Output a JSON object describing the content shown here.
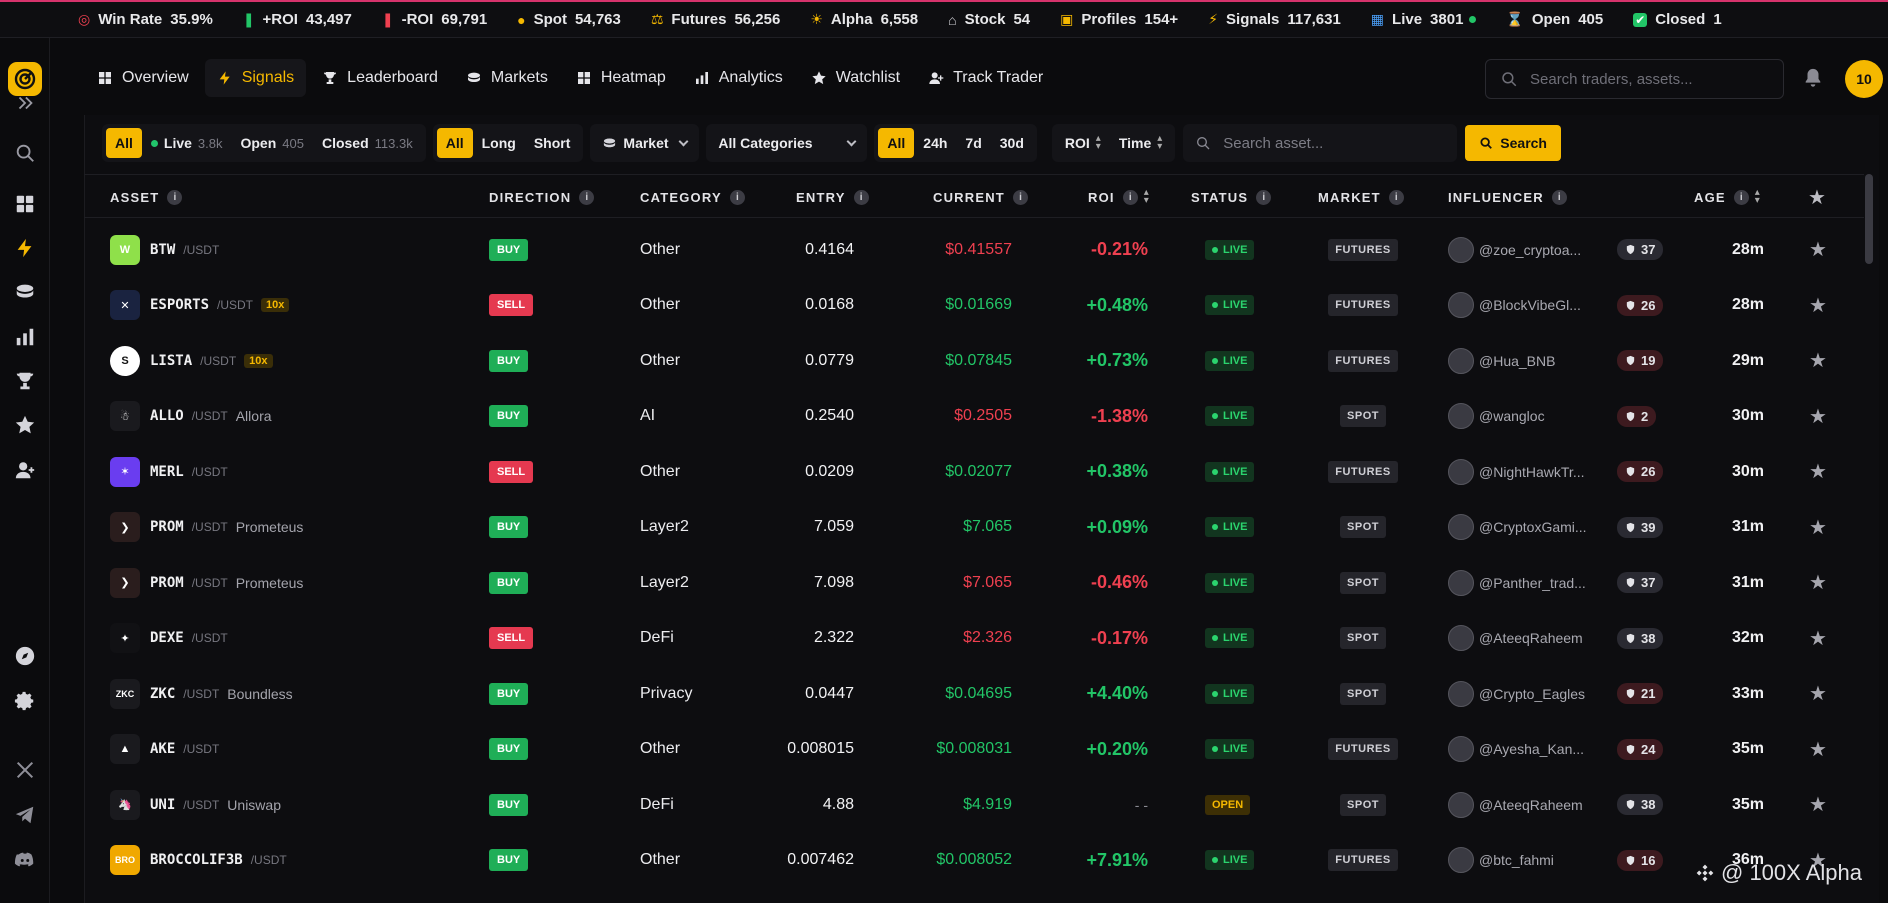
{
  "ticker": [
    {
      "icon": "target-icon",
      "label": "Win Rate",
      "value": "35.9%",
      "color": "#ef4050"
    },
    {
      "icon": "candle-green-icon",
      "label": "+ROI",
      "value": "43,497",
      "color": "#22c567"
    },
    {
      "icon": "candle-red-icon",
      "label": "-ROI",
      "value": "69,791",
      "color": "#ef4050"
    },
    {
      "icon": "coin-icon",
      "label": "Spot",
      "value": "54,763",
      "color": "#f5b800"
    },
    {
      "icon": "scale-icon",
      "label": "Futures",
      "value": "56,256",
      "color": "#f5b800"
    },
    {
      "icon": "sun-icon",
      "label": "Alpha",
      "value": "6,558",
      "color": "#f5b800"
    },
    {
      "icon": "bank-icon",
      "label": "Stock",
      "value": "54",
      "color": "#cfcfd4"
    },
    {
      "icon": "profile-card-icon",
      "label": "Profiles",
      "value": "154+",
      "color": "#f5b800"
    },
    {
      "icon": "lightning-icon",
      "label": "Signals",
      "value": "117,631",
      "color": "#f5b800"
    },
    {
      "icon": "chart-icon",
      "label": "Live",
      "value": "3801",
      "color": "#4a9df5"
    },
    {
      "icon": "hourglass-icon",
      "label": "Open",
      "value": "405",
      "color": "#f5b800"
    },
    {
      "icon": "check-icon",
      "label": "Closed",
      "value": "1",
      "color": "#22c567"
    }
  ],
  "nav": [
    {
      "label": "Overview",
      "icon": "grid-icon",
      "active": false
    },
    {
      "label": "Signals",
      "icon": "lightning-icon",
      "active": true
    },
    {
      "label": "Leaderboard",
      "icon": "trophy-icon",
      "active": false
    },
    {
      "label": "Markets",
      "icon": "coins-icon",
      "active": false
    },
    {
      "label": "Heatmap",
      "icon": "heatmap-icon",
      "active": false
    },
    {
      "label": "Analytics",
      "icon": "bar-chart-icon",
      "active": false
    },
    {
      "label": "Watchlist",
      "icon": "star-icon",
      "active": false
    },
    {
      "label": "Track Trader",
      "icon": "user-plus-icon",
      "active": false
    }
  ],
  "search": {
    "placeholder": "Search traders, assets..."
  },
  "notifications": {
    "count": "10"
  },
  "filters": {
    "status": [
      {
        "label": "All",
        "count": "",
        "on": true
      },
      {
        "label": "Live",
        "count": "3.8k",
        "on": false
      },
      {
        "label": "Open",
        "count": "405",
        "on": false
      },
      {
        "label": "Closed",
        "count": "113.3k",
        "on": false
      }
    ],
    "direction": [
      {
        "label": "All",
        "on": true
      },
      {
        "label": "Long",
        "on": false
      },
      {
        "label": "Short",
        "on": false
      }
    ],
    "market_dropdown": "Market",
    "category_dropdown": "All Categories",
    "time": [
      {
        "label": "All",
        "on": true
      },
      {
        "label": "24h",
        "on": false
      },
      {
        "label": "7d",
        "on": false
      },
      {
        "label": "30d",
        "on": false
      }
    ],
    "sort_roi": "ROI",
    "sort_time": "Time",
    "asset_placeholder": "Search asset...",
    "search_button": "Search"
  },
  "table": {
    "headers": {
      "asset": "ASSET",
      "direction": "DIRECTION",
      "category": "CATEGORY",
      "entry": "ENTRY",
      "current": "CURRENT",
      "roi": "ROI",
      "status": "STATUS",
      "market": "MARKET",
      "influencer": "INFLUENCER",
      "age": "AGE"
    },
    "rows": [
      {
        "symbol": "BTW",
        "pair": "/USDT",
        "lev": "",
        "name": "",
        "coin_color": "#8fe04a",
        "coin_text": "W",
        "dir": "BUY",
        "category": "Other",
        "entry": "0.4164",
        "current": "$0.41557",
        "current_color": "red",
        "roi": "-0.21%",
        "roi_color": "red",
        "status": "LIVE",
        "market": "FUTURES",
        "handle": "@zoe_cryptoa...",
        "score": "37",
        "score_tone": "gray",
        "age": "28m"
      },
      {
        "symbol": "ESPORTS",
        "pair": "/USDT",
        "lev": "10x",
        "name": "",
        "coin_color": "#1a2340",
        "coin_text": "✕",
        "dir": "SELL",
        "category": "Other",
        "entry": "0.0168",
        "current": "$0.01669",
        "current_color": "green",
        "roi": "+0.48%",
        "roi_color": "green",
        "status": "LIVE",
        "market": "FUTURES",
        "handle": "@BlockVibeGl...",
        "score": "26",
        "score_tone": "red",
        "age": "28m"
      },
      {
        "symbol": "LISTA",
        "pair": "/USDT",
        "lev": "10x",
        "name": "",
        "coin_color": "#ffffff",
        "coin_text": "S",
        "dir": "BUY",
        "category": "Other",
        "entry": "0.0779",
        "current": "$0.07845",
        "current_color": "green",
        "roi": "+0.73%",
        "roi_color": "green",
        "status": "LIVE",
        "market": "FUTURES",
        "handle": "@Hua_BNB",
        "score": "19",
        "score_tone": "red",
        "age": "29m"
      },
      {
        "symbol": "ALLO",
        "pair": "/USDT",
        "lev": "",
        "name": "Allora",
        "coin_color": "#1a1a1e",
        "coin_text": "☃",
        "dir": "BUY",
        "category": "AI",
        "entry": "0.2540",
        "current": "$0.2505",
        "current_color": "red",
        "roi": "-1.38%",
        "roi_color": "red",
        "status": "LIVE",
        "market": "SPOT",
        "handle": "@wangloc",
        "score": "2",
        "score_tone": "red",
        "age": "30m"
      },
      {
        "symbol": "MERL",
        "pair": "/USDT",
        "lev": "",
        "name": "",
        "coin_color": "#6a3df0",
        "coin_text": "✶",
        "dir": "SELL",
        "category": "Other",
        "entry": "0.0209",
        "current": "$0.02077",
        "current_color": "green",
        "roi": "+0.38%",
        "roi_color": "green",
        "status": "LIVE",
        "market": "FUTURES",
        "handle": "@NightHawkTr...",
        "score": "26",
        "score_tone": "red",
        "age": "30m"
      },
      {
        "symbol": "PROM",
        "pair": "/USDT",
        "lev": "",
        "name": "Prometeus",
        "coin_color": "#2a1d1d",
        "coin_text": "❯",
        "dir": "BUY",
        "category": "Layer2",
        "entry": "7.059",
        "current": "$7.065",
        "current_color": "green",
        "roi": "+0.09%",
        "roi_color": "green",
        "status": "LIVE",
        "market": "SPOT",
        "handle": "@CryptoxGami...",
        "score": "39",
        "score_tone": "gray",
        "age": "31m"
      },
      {
        "symbol": "PROM",
        "pair": "/USDT",
        "lev": "",
        "name": "Prometeus",
        "coin_color": "#2a1d1d",
        "coin_text": "❯",
        "dir": "BUY",
        "category": "Layer2",
        "entry": "7.098",
        "current": "$7.065",
        "current_color": "red",
        "roi": "-0.46%",
        "roi_color": "red",
        "status": "LIVE",
        "market": "SPOT",
        "handle": "@Panther_trad...",
        "score": "37",
        "score_tone": "gray",
        "age": "31m"
      },
      {
        "symbol": "DEXE",
        "pair": "/USDT",
        "lev": "",
        "name": "",
        "coin_color": "#111114",
        "coin_text": "✦",
        "dir": "SELL",
        "category": "DeFi",
        "entry": "2.322",
        "current": "$2.326",
        "current_color": "red",
        "roi": "-0.17%",
        "roi_color": "red",
        "status": "LIVE",
        "market": "SPOT",
        "handle": "@AteeqRaheem",
        "score": "38",
        "score_tone": "gray",
        "age": "32m"
      },
      {
        "symbol": "ZKC",
        "pair": "/USDT",
        "lev": "",
        "name": "Boundless",
        "coin_color": "#1a1a1e",
        "coin_text": "ZKC",
        "dir": "BUY",
        "category": "Privacy",
        "entry": "0.0447",
        "current": "$0.04695",
        "current_color": "green",
        "roi": "+4.40%",
        "roi_color": "green",
        "status": "LIVE",
        "market": "SPOT",
        "handle": "@Crypto_Eagles",
        "score": "21",
        "score_tone": "red",
        "age": "33m"
      },
      {
        "symbol": "AKE",
        "pair": "/USDT",
        "lev": "",
        "name": "",
        "coin_color": "#1a1a1e",
        "coin_text": "▲",
        "dir": "BUY",
        "category": "Other",
        "entry": "0.008015",
        "current": "$0.008031",
        "current_color": "green",
        "roi": "+0.20%",
        "roi_color": "green",
        "status": "LIVE",
        "market": "FUTURES",
        "handle": "@Ayesha_Kan...",
        "score": "24",
        "score_tone": "red",
        "age": "35m"
      },
      {
        "symbol": "UNI",
        "pair": "/USDT",
        "lev": "",
        "name": "Uniswap",
        "coin_color": "#1a1a1e",
        "coin_text": "🦄",
        "dir": "BUY",
        "category": "DeFi",
        "entry": "4.88",
        "current": "$4.919",
        "current_color": "green",
        "roi": "- -",
        "roi_color": "muted",
        "status": "OPEN",
        "market": "SPOT",
        "handle": "@AteeqRaheem",
        "score": "38",
        "score_tone": "gray",
        "age": "35m"
      },
      {
        "symbol": "BROCCOLIF3B",
        "pair": "/USDT",
        "lev": "",
        "name": "",
        "coin_color": "#f0a800",
        "coin_text": "BRO",
        "dir": "BUY",
        "category": "Other",
        "entry": "0.007462",
        "current": "$0.008052",
        "current_color": "green",
        "roi": "+7.91%",
        "roi_color": "green",
        "status": "LIVE",
        "market": "FUTURES",
        "handle": "@btc_fahmi",
        "score": "16",
        "score_tone": "red",
        "age": "36m"
      }
    ]
  },
  "watermark": "@ 100X Alpha"
}
